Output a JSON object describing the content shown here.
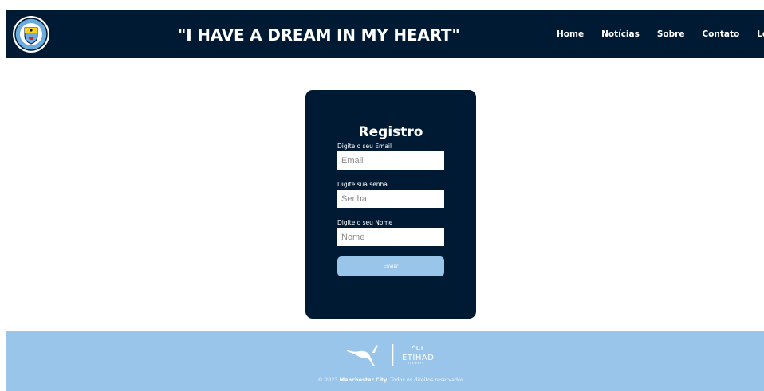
{
  "header": {
    "logo_name": "manchester-city-crest",
    "slogan": "\"I HAVE A DREAM IN MY HEART\"",
    "nav": [
      {
        "label": "Home"
      },
      {
        "label": "Notícias"
      },
      {
        "label": "Sobre"
      },
      {
        "label": "Contato"
      },
      {
        "label": "Login"
      }
    ]
  },
  "form": {
    "title": "Registro",
    "email_label": "Digite o seu Email",
    "email_placeholder": "Email",
    "password_label": "Digite sua senha",
    "password_placeholder": "Senha",
    "name_label": "Digite o seu Nome",
    "name_placeholder": "Nome",
    "submit_label": "Enviar"
  },
  "footer": {
    "sponsor_1": "puma-logo",
    "sponsor_2": "etihad-logo",
    "copyright_prefix": "© 2023 ",
    "copyright_brand": "Manchester City",
    "copyright_suffix": ". Todos os direitos reservados."
  },
  "colors": {
    "navy": "#001a33",
    "sky_blue": "#98c5e9",
    "white": "#ffffff"
  }
}
